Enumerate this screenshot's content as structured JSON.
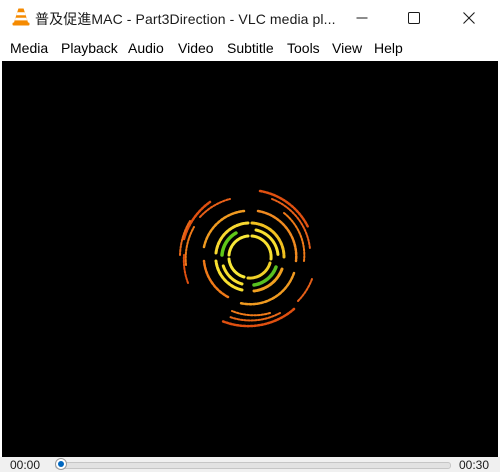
{
  "window": {
    "title": "普及促進MAC - Part3Direction - VLC media pl...",
    "app_icon": "vlc-cone-icon",
    "controls": {
      "minimize": "minimize-icon",
      "maximize": "maximize-icon",
      "close": "close-icon"
    }
  },
  "menu": {
    "items": [
      {
        "label": "Media"
      },
      {
        "label": "Playback"
      },
      {
        "label": "Audio"
      },
      {
        "label": "Video"
      },
      {
        "label": "Subtitle"
      },
      {
        "label": "Tools"
      },
      {
        "label": "View"
      },
      {
        "label": "Help"
      }
    ]
  },
  "video": {
    "background": "#000000",
    "visualization": "spectrum-rings"
  },
  "seek": {
    "elapsed": "00:00",
    "total": "00:30",
    "progress": 0.0,
    "accent": "#0067c0"
  },
  "colors": {
    "ring_orange": "#e85a10",
    "ring_amber": "#f0a020",
    "ring_yellow": "#f8e030",
    "ring_green": "#40c020"
  }
}
